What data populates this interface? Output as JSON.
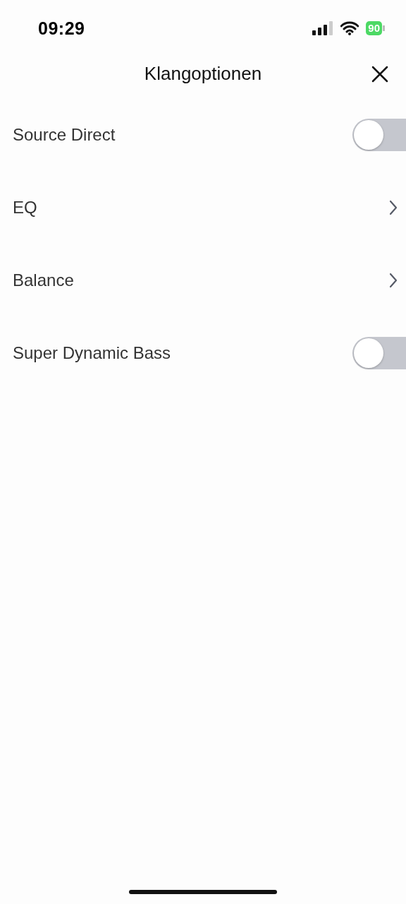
{
  "status_bar": {
    "time": "09:29",
    "battery": "90"
  },
  "header": {
    "title": "Klangoptionen"
  },
  "options": [
    {
      "label": "Source Direct",
      "kind": "toggle",
      "on": false
    },
    {
      "label": "EQ",
      "kind": "link"
    },
    {
      "label": "Balance",
      "kind": "link"
    },
    {
      "label": "Super Dynamic Bass",
      "kind": "toggle",
      "on": false
    }
  ]
}
